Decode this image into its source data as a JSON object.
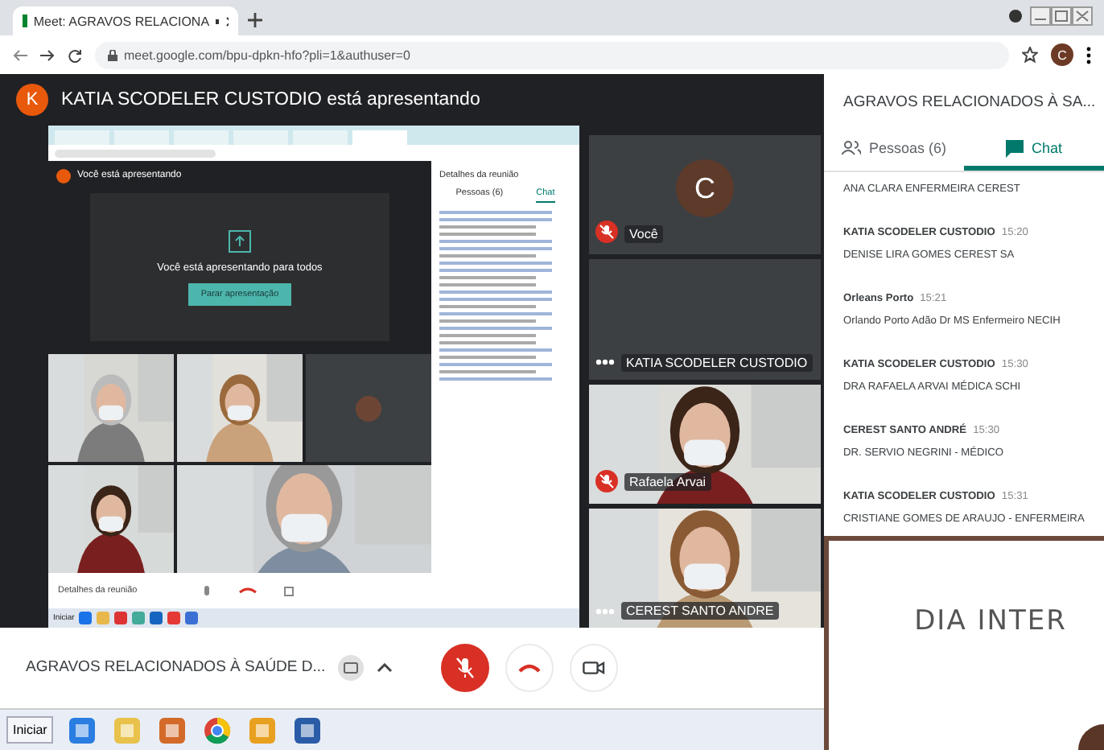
{
  "browser": {
    "tab_title": "Meet: AGRAVOS RELACIONA",
    "url": "meet.google.com/bpu-dpkn-hfo?pli=1&authuser=0",
    "profile_initial": "C"
  },
  "presenter": {
    "initial": "K",
    "text": "KATIA SCODELER CUSTODIO está apresentando"
  },
  "shared_screen": {
    "banner": "Você está apresentando",
    "card_text": "Você está apresentando para todos",
    "button": "Parar apresentação",
    "panel_title": "Detalhes da reunião",
    "tabs": [
      {
        "label": "Pessoas (6)",
        "selected": false
      },
      {
        "label": "Chat",
        "selected": true
      }
    ],
    "bar_label": "Detalhes da reunião",
    "start": "Iniciar"
  },
  "tiles": [
    {
      "kind": "avatar",
      "initial": "C",
      "name": "Você",
      "muted": true
    },
    {
      "kind": "avatar",
      "name": "KATIA SCODELER CUSTODIO",
      "muted": false
    },
    {
      "kind": "video",
      "name": "Rafaela Arvai",
      "muted": true
    },
    {
      "kind": "video",
      "name": "CEREST SANTO ANDRE",
      "muted": false
    }
  ],
  "chat": {
    "title": "AGRAVOS RELACIONADOS À SA...",
    "tabs": [
      {
        "label": "Pessoas (6)",
        "selected": false
      },
      {
        "label": "Chat",
        "selected": true
      }
    ],
    "messages": [
      {
        "text": "ANA CLARA ENFERMEIRA CEREST"
      },
      {
        "sender": "KATIA SCODELER CUSTODIO",
        "time": "15:20",
        "text": "DENISE LIRA GOMES CEREST SA"
      },
      {
        "sender": "Orleans Porto",
        "time": "15:21",
        "text": "Orlando Porto Adão Dr MS Enfermeiro NECIH"
      },
      {
        "sender": "KATIA SCODELER CUSTODIO",
        "time": "15:30",
        "text": "DRA RAFAELA ARVAI MÉDICA SCHI"
      },
      {
        "sender": "CEREST SANTO ANDRÉ",
        "time": "15:30",
        "text": "DR. SERVIO NEGRINI - MÉDICO"
      },
      {
        "sender": "KATIA SCODELER CUSTODIO",
        "time": "15:31",
        "text": "CRISTIANE GOMES DE ARAUJO - ENFERMEIRA"
      }
    ]
  },
  "bottom_bar": {
    "title": "AGRAVOS RELACIONADOS À SAÚDE D...",
    "mic_muted": true
  },
  "taskbar": {
    "start": "Iniciar"
  },
  "overlay_window": {
    "text": "DIA INTER"
  }
}
